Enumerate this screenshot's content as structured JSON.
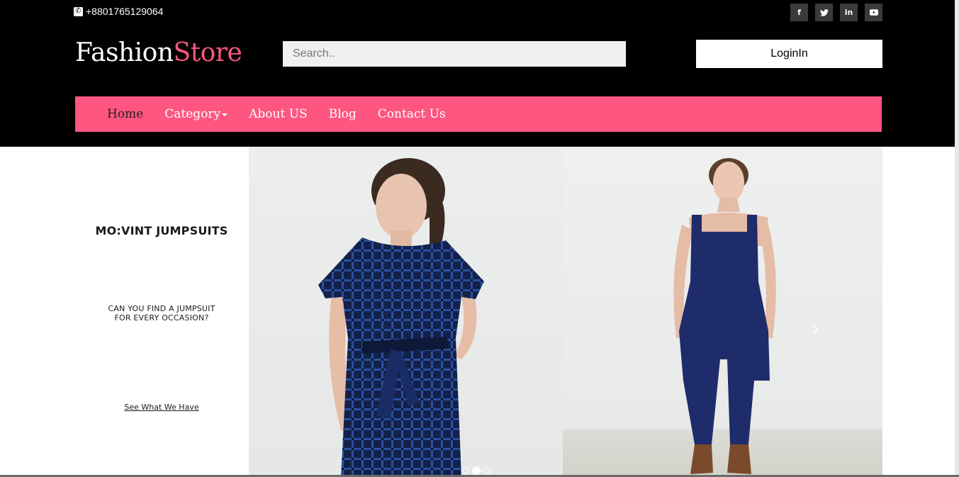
{
  "topbar": {
    "phone": "+8801765129064",
    "social": [
      {
        "icon": "facebook-icon",
        "glyph": "f"
      },
      {
        "icon": "twitter-icon",
        "glyph": "t"
      },
      {
        "icon": "linkedin-icon",
        "glyph": "in"
      },
      {
        "icon": "youtube-icon",
        "glyph": "▶"
      }
    ]
  },
  "logo": {
    "part1": "Fashion",
    "part2": "Store"
  },
  "search": {
    "placeholder": "Search.."
  },
  "login": {
    "label": "LoginIn"
  },
  "nav": {
    "items": [
      {
        "label": "Home",
        "active": true
      },
      {
        "label": "Category",
        "dropdown": true
      },
      {
        "label": "About US"
      },
      {
        "label": "Blog"
      },
      {
        "label": "Contact Us"
      }
    ]
  },
  "carousel": {
    "promo_title": "MO:VINT JUMPSUITS",
    "promo_subtitle_line1": "CAN YOU FIND A JUMPSUIT",
    "promo_subtitle_line2": "FOR EVERY OCCASION?",
    "promo_link": "See What We Have",
    "prev_glyph": "‹",
    "next_glyph": "›",
    "slide_count": 3,
    "active_slide": 2
  },
  "colors": {
    "accent": "#fe5680",
    "header_bg": "#000000",
    "checked_jumpsuit": "#1c2a5c",
    "navy_jumpsuit": "#1f2c6b"
  }
}
